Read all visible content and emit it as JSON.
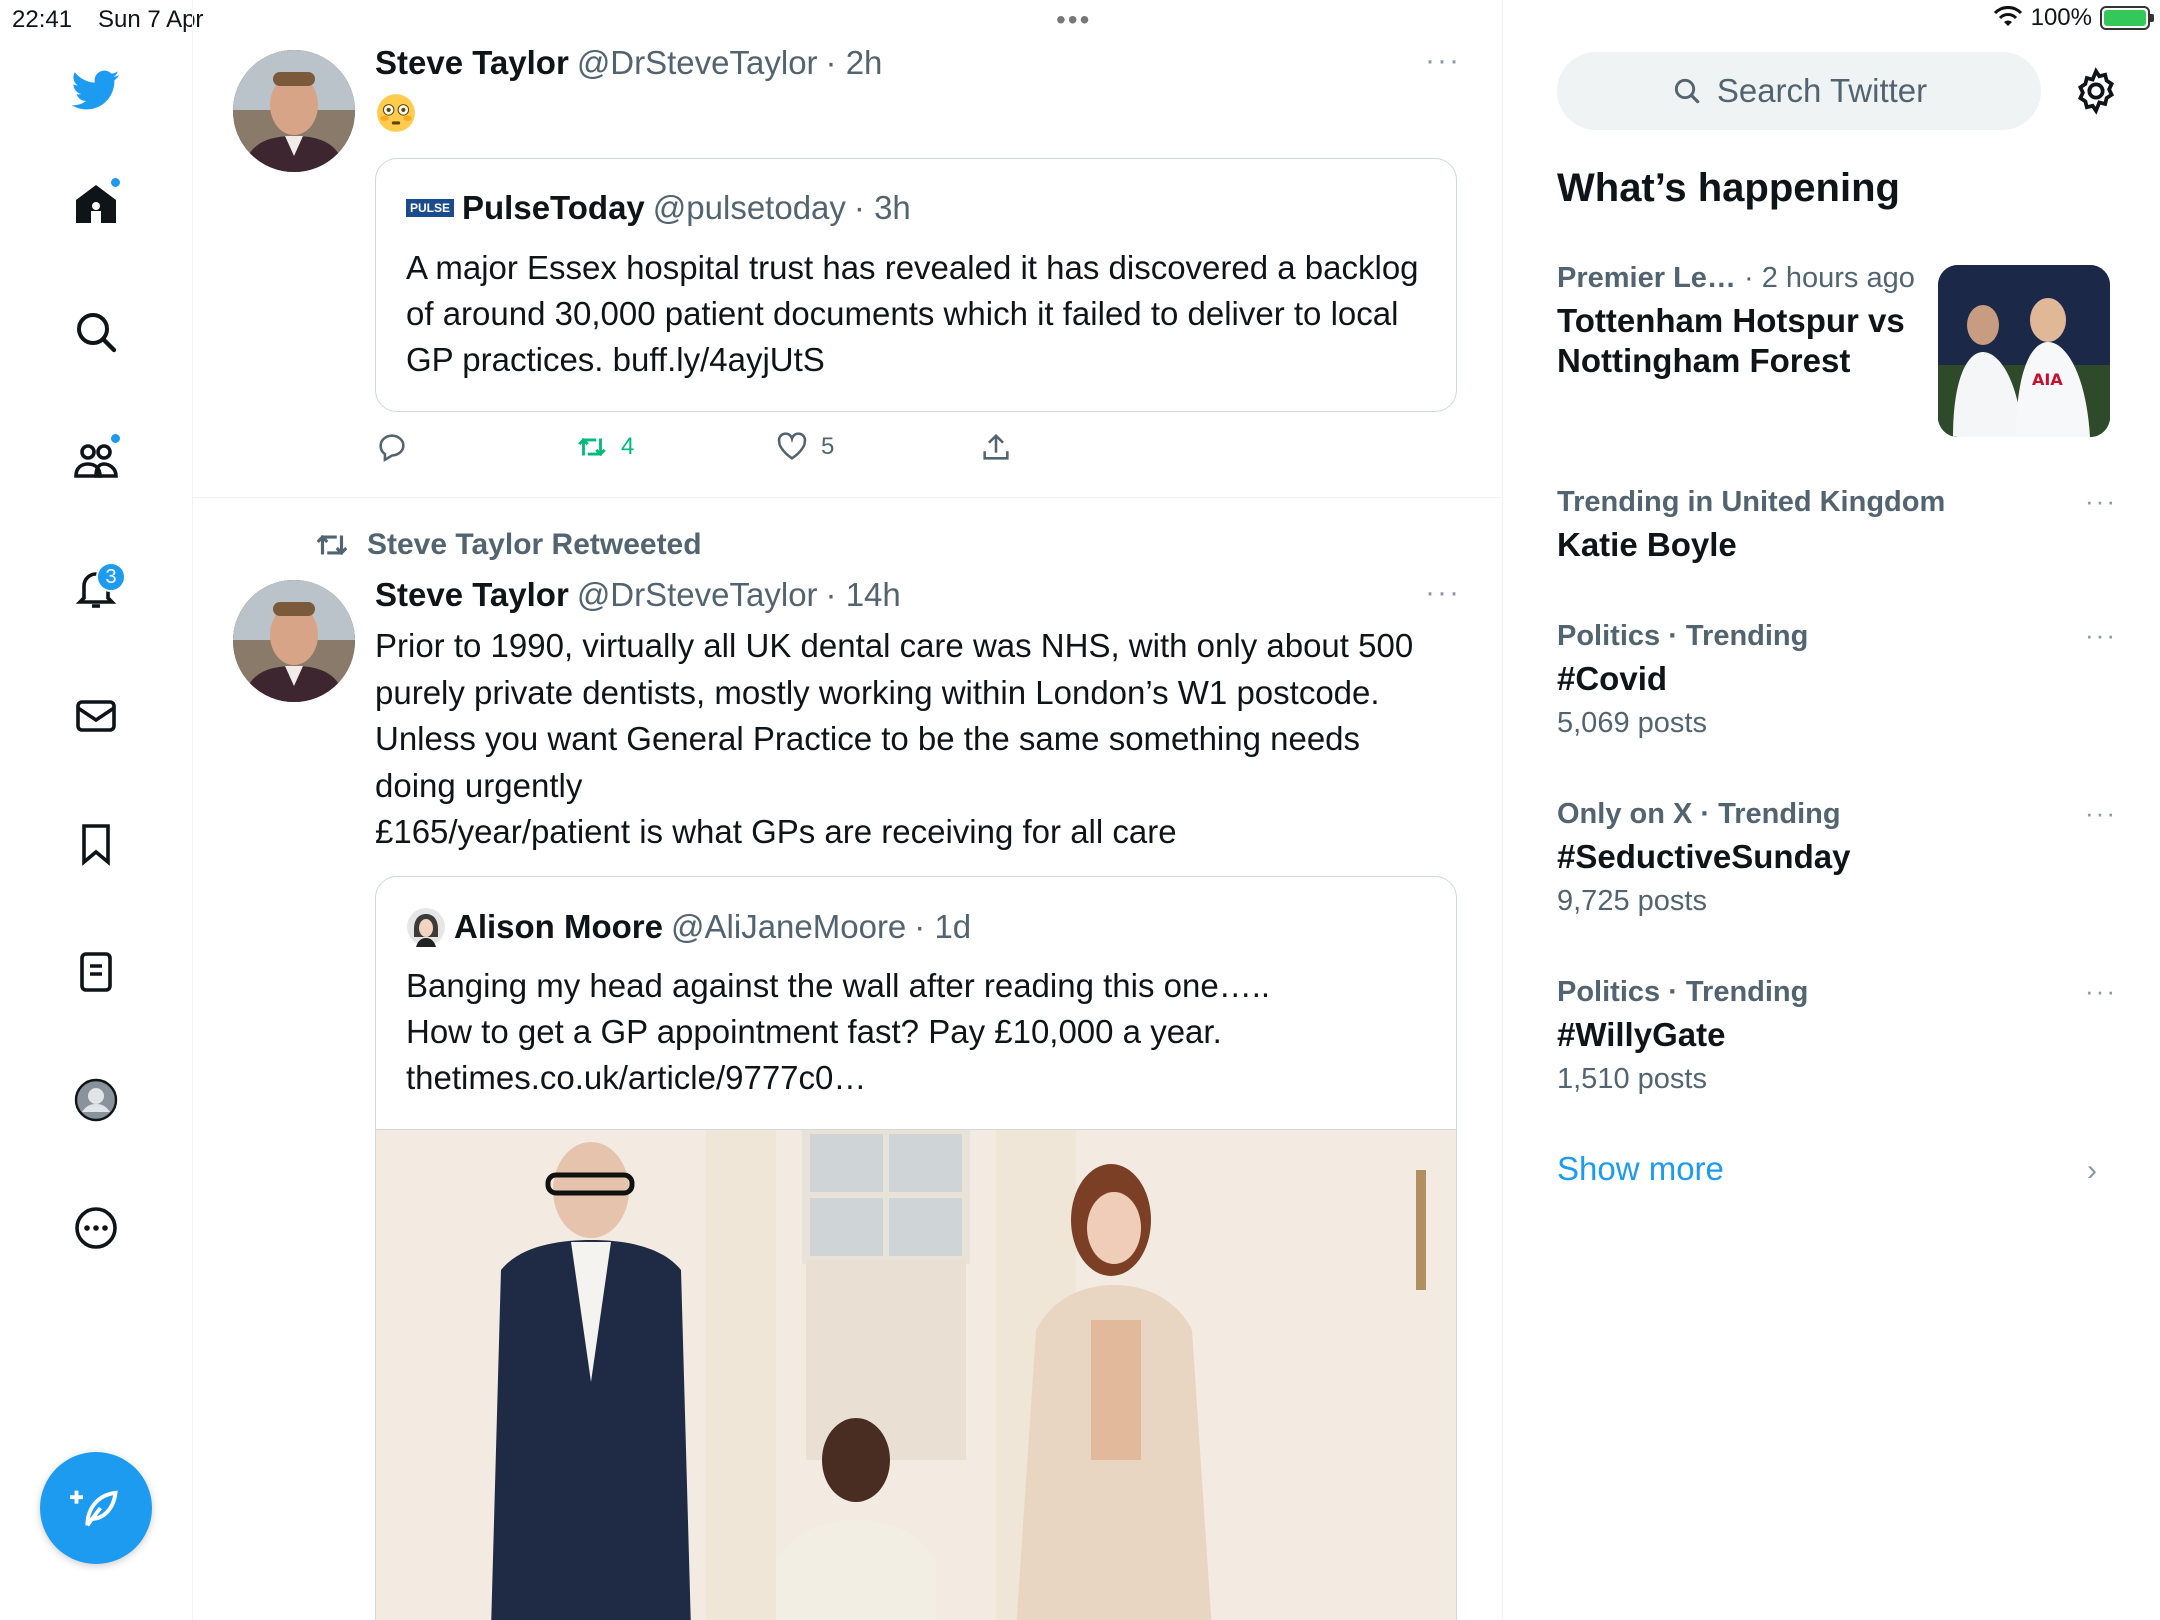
{
  "status": {
    "time": "22:41",
    "date": "Sun 7 Apr",
    "dots": "•••",
    "battery": "100%"
  },
  "nav": {
    "notifications_badge": "3"
  },
  "tweets": [
    {
      "name": "Steve Taylor",
      "handle": "@DrSteveTaylor",
      "time": "· 2h",
      "more": "···",
      "quote": {
        "name": "PulseToday",
        "handle": "@pulsetoday",
        "time": "· 3h",
        "logo": "PULSE",
        "text": "A major Essex hospital trust has revealed it has discovered a backlog of around 30,000 patient documents which it failed to deliver to local GP practices. buff.ly/4ayjUtS"
      },
      "retweets": "4",
      "likes": "5"
    },
    {
      "retweeted_by": "Steve Taylor Retweeted",
      "name": "Steve Taylor",
      "handle": "@DrSteveTaylor",
      "time": "· 14h",
      "more": "···",
      "lines": [
        "Prior to 1990, virtually all UK dental care was NHS, with only about 500",
        "purely private dentists, mostly working within London’s W1 postcode.",
        "Unless you want General Practice to be the same something needs",
        "doing urgently",
        "£165/year/patient is what GPs are receiving for all care"
      ],
      "quote": {
        "name": "Alison Moore",
        "handle": "@AliJaneMoore",
        "time": "· 1d",
        "lines": [
          "Banging my head against the wall after reading this one…..",
          "How to get a GP appointment fast? Pay £10,000 a year.",
          "thetimes.co.uk/article/9777c0…"
        ]
      }
    }
  ],
  "right": {
    "search_placeholder": "Search Twitter",
    "heading": "What’s happening",
    "featured": {
      "category": "Premier Le…",
      "time": " · 2 hours ago",
      "title_line1": "Tottenham Hotspur vs",
      "title_line2": "Nottingham Forest"
    },
    "trends": [
      {
        "meta": "Trending in United Kingdom",
        "title": "Katie Boyle",
        "count": ""
      },
      {
        "meta": "Politics · Trending",
        "title": "#Covid",
        "count": "5,069 posts"
      },
      {
        "meta": "Only on X · Trending",
        "title": "#SeductiveSunday",
        "count": "9,725 posts"
      },
      {
        "meta": "Politics · Trending",
        "title": "#WillyGate",
        "count": "1,510 posts"
      }
    ],
    "more": "···",
    "show_more": "Show more"
  },
  "colors": {
    "accent": "#1d9bf0",
    "retweet": "#00ba7c",
    "muted": "#536471"
  },
  "icons": [
    "twitter-logo-icon",
    "home-icon",
    "search-icon",
    "communities-icon",
    "bell-icon",
    "mail-icon",
    "bookmark-icon",
    "lists-icon",
    "profile-icon",
    "more-circle-icon",
    "compose-icon",
    "reply-icon",
    "retweet-icon",
    "like-icon",
    "share-icon",
    "gear-icon",
    "chevron-right-icon"
  ]
}
